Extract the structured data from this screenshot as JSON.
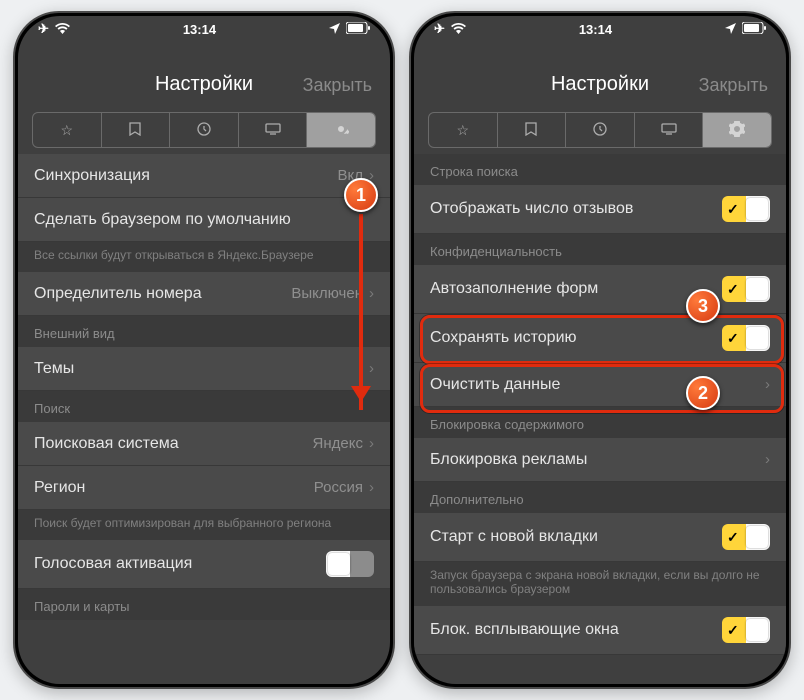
{
  "status": {
    "time": "13:14"
  },
  "header": {
    "title": "Настройки",
    "close": "Закрыть"
  },
  "callouts": {
    "c1": "1",
    "c2": "2",
    "c3": "3"
  },
  "left": {
    "sync": {
      "label": "Синхронизация",
      "value": "Вкл"
    },
    "defaultBrowser": {
      "label": "Сделать браузером по умолчанию"
    },
    "defaultNote": "Все ссылки будут открываться в Яндекс.Браузере",
    "callerId": {
      "label": "Определитель номера",
      "value": "Выключен"
    },
    "section_appearance": "Внешний вид",
    "themes": {
      "label": "Темы"
    },
    "section_search": "Поиск",
    "searchEngine": {
      "label": "Поисковая система",
      "value": "Яндекс"
    },
    "region": {
      "label": "Регион",
      "value": "Россия"
    },
    "regionNote": "Поиск будет оптимизирован для выбранного региона",
    "voice": {
      "label": "Голосовая активация"
    },
    "section_pwcards": "Пароли и карты"
  },
  "right": {
    "section_searchbar": "Строка поиска",
    "reviews": {
      "label": "Отображать число отзывов"
    },
    "section_privacy": "Конфиденциальность",
    "autofill": {
      "label": "Автозаполнение форм"
    },
    "history": {
      "label": "Сохранять историю"
    },
    "clear": {
      "label": "Очистить данные"
    },
    "section_block": "Блокировка содержимого",
    "adblock": {
      "label": "Блокировка рекламы"
    },
    "section_additional": "Дополнительно",
    "newtab": {
      "label": "Старт с новой вкладки"
    },
    "newtabNote": "Запуск браузера с экрана новой вкладки, если вы долго не пользовались браузером",
    "popups": {
      "label": "Блок. всплывающие окна"
    }
  }
}
